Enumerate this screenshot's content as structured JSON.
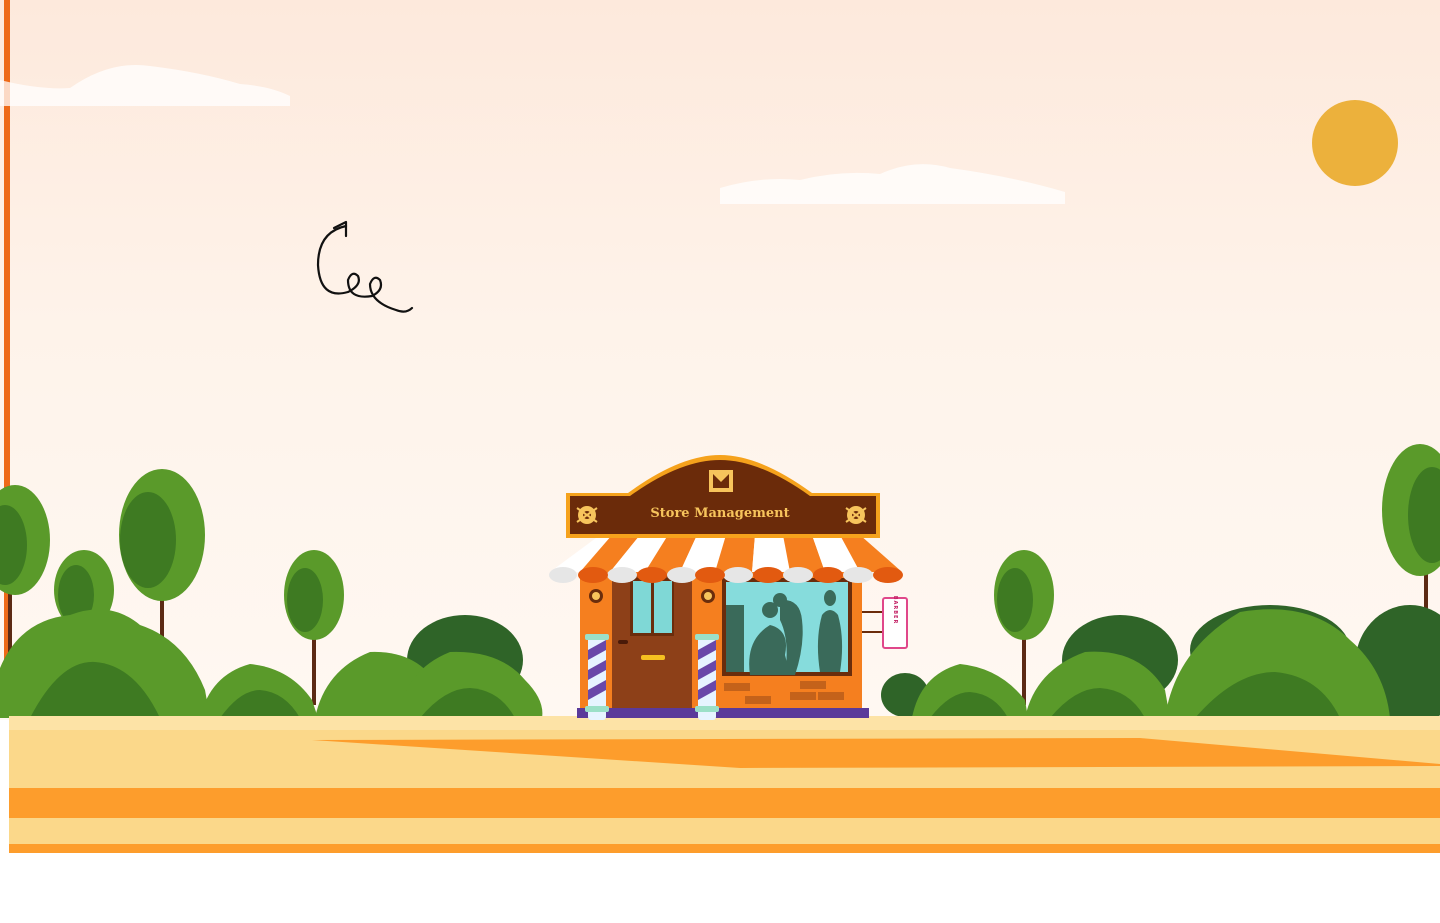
{
  "scene": {
    "store_sign": "Store Management",
    "side_sign": "BARBER"
  },
  "colors": {
    "accent": "#ee6a18",
    "sun": "#ecb13c",
    "sky_top": "#fde9dc",
    "ground_light": "#fbd88a",
    "ground_stripe": "#fd9d2c",
    "tree_light": "#5a9a2a",
    "tree_dark": "#2f6428",
    "sign_brown": "#6b2b0a"
  }
}
